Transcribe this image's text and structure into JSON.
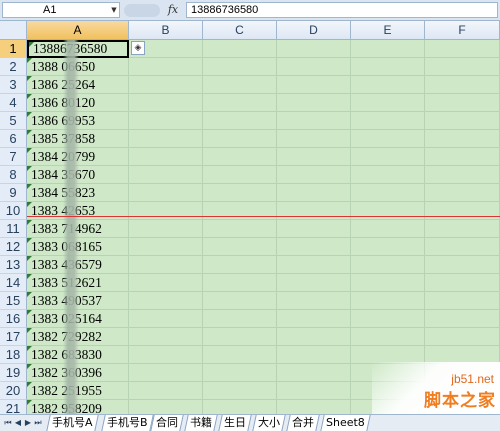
{
  "formula_bar": {
    "name_box": "A1",
    "fx_label": "fx",
    "formula_value": "13886736580"
  },
  "columns": [
    "A",
    "B",
    "C",
    "D",
    "E",
    "F"
  ],
  "rows": [
    {
      "num": "1",
      "a": "13886736580"
    },
    {
      "num": "2",
      "a": "1388   06650"
    },
    {
      "num": "3",
      "a": "1386   25264"
    },
    {
      "num": "4",
      "a": "1386   80120"
    },
    {
      "num": "5",
      "a": "1386   69953"
    },
    {
      "num": "6",
      "a": "1385   37858"
    },
    {
      "num": "7",
      "a": "1384   20799"
    },
    {
      "num": "8",
      "a": "1384   35670"
    },
    {
      "num": "9",
      "a": "1384   55823"
    },
    {
      "num": "10",
      "a": "1383   42653"
    },
    {
      "num": "11",
      "a": "1383   714962"
    },
    {
      "num": "12",
      "a": "1383   068165"
    },
    {
      "num": "13",
      "a": "1383   436579"
    },
    {
      "num": "14",
      "a": "1383   512621"
    },
    {
      "num": "15",
      "a": "1383   490537"
    },
    {
      "num": "16",
      "a": "1383   025164"
    },
    {
      "num": "17",
      "a": "1382   729282"
    },
    {
      "num": "18",
      "a": "1382   683830"
    },
    {
      "num": "19",
      "a": "1382   360396"
    },
    {
      "num": "20",
      "a": "1382   251955"
    },
    {
      "num": "21",
      "a": "1382   958209"
    }
  ],
  "sheet_tabs": [
    "手机号A",
    "手机号B",
    "合同",
    "书籍",
    "生日",
    "大小",
    "合并",
    "Sheet8"
  ],
  "watermark": {
    "url": "jb51.net",
    "site": "脚本之家"
  }
}
